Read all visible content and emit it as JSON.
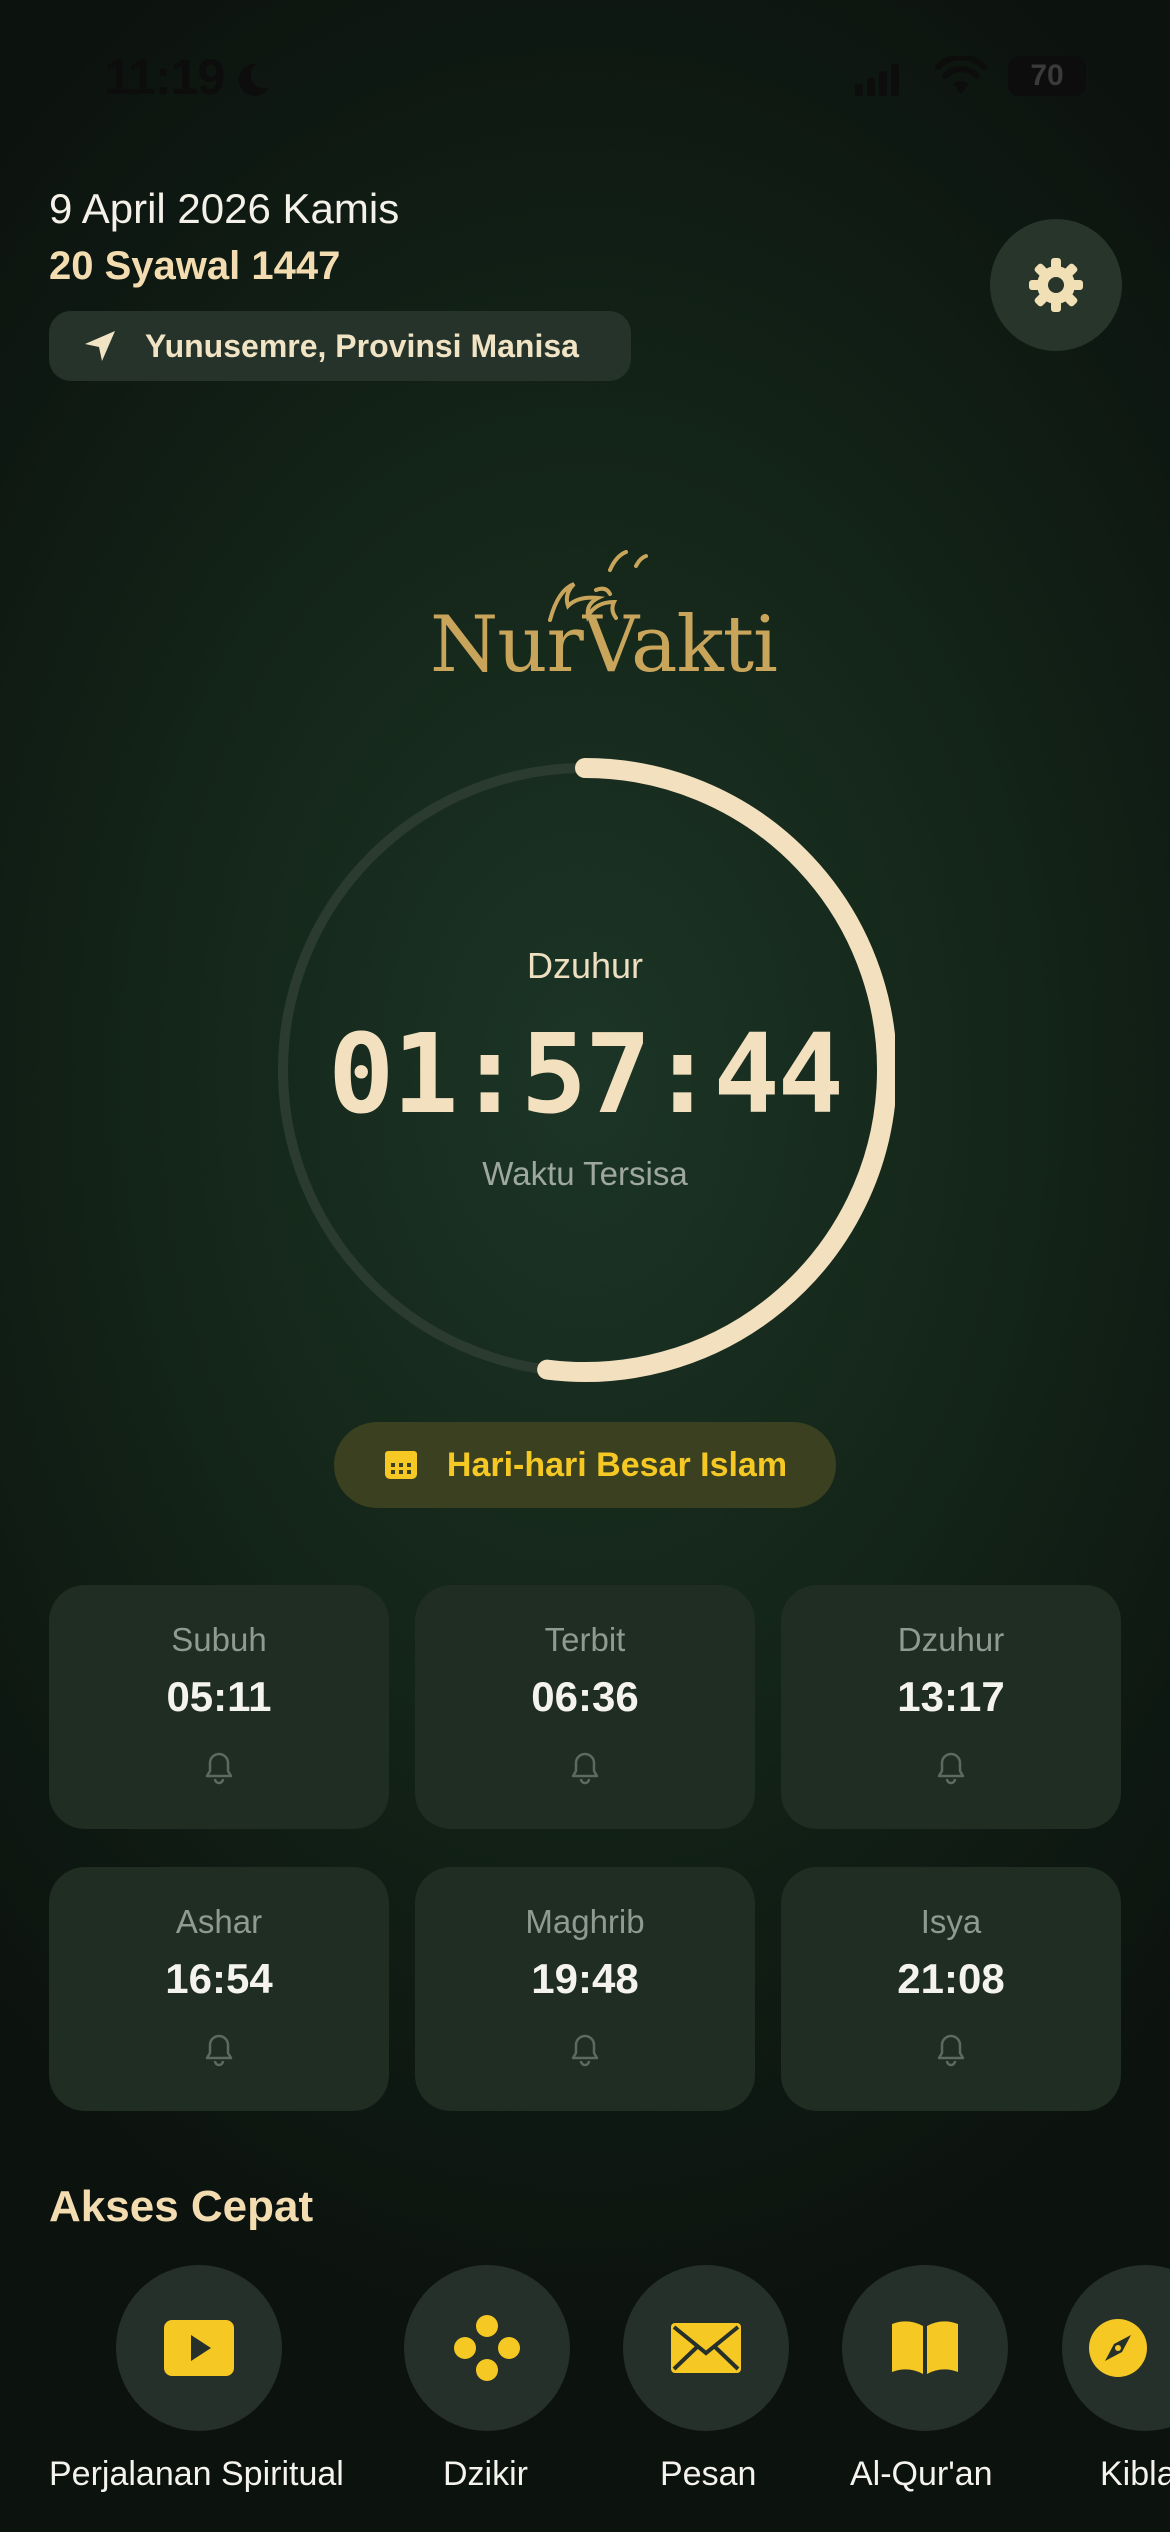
{
  "status_bar": {
    "time": "11:19",
    "battery": "70"
  },
  "header": {
    "gregorian_date": "9 April 2026 Kamis",
    "hijri_date": "20 Syawal 1447",
    "location": "Yunusemre, Provinsi Manisa"
  },
  "logo": {
    "text": "NurVakti",
    "arabic": "النور"
  },
  "countdown": {
    "next_prayer": "Dzuhur",
    "time_left": "01:57:44",
    "caption": "Waktu Tersisa",
    "progress": 0.52
  },
  "events_button": {
    "label": "Hari-hari Besar Islam"
  },
  "prayers": [
    {
      "name": "Subuh",
      "time": "05:11"
    },
    {
      "name": "Terbit",
      "time": "06:36"
    },
    {
      "name": "Dzuhur",
      "time": "13:17"
    },
    {
      "name": "Ashar",
      "time": "16:54"
    },
    {
      "name": "Maghrib",
      "time": "19:48"
    },
    {
      "name": "Isya",
      "time": "21:08"
    }
  ],
  "quick_access": {
    "title": "Akses Cepat",
    "items": [
      {
        "label": "Perjalanan Spiritual",
        "icon": "play-icon"
      },
      {
        "label": "Dzikir",
        "icon": "dots-icon"
      },
      {
        "label": "Pesan",
        "icon": "envelope-icon"
      },
      {
        "label": "Al-Qur'an",
        "icon": "book-icon"
      },
      {
        "label": "Kibla",
        "icon": "compass-icon"
      }
    ]
  },
  "colors": {
    "accent_gold": "#f5c824",
    "cream": "#f3e0bf",
    "background": "#142619",
    "card": "#1f2d23"
  }
}
